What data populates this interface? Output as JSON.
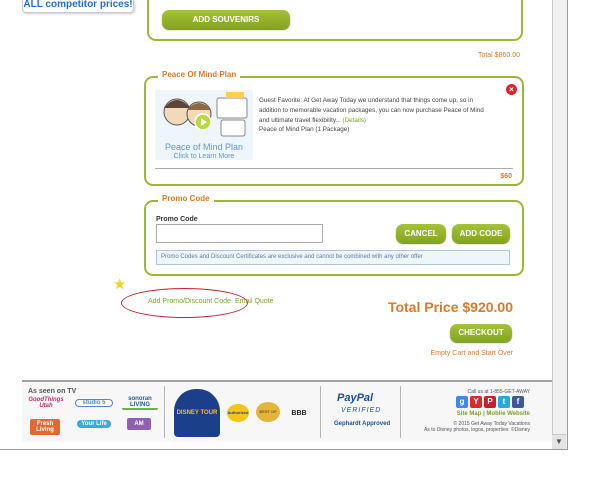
{
  "colors": {
    "accent_green": "#9ab73a",
    "orange": "#d9792a",
    "link_green": "#7ca324",
    "alert_red": "#d8242a"
  },
  "promo_stub": {
    "text": "ALL competitor prices!"
  },
  "souvenirs": {
    "button_label": "ADD SOUVENIRS",
    "total": "Total $860.00"
  },
  "peace_of_mind": {
    "legend": "Peace Of Mind Plan",
    "image_title": "Peace of Mind Plan",
    "image_subtitle": "Click to Learn More",
    "description": "Guest Favorite: At Get Away Today we understand that things come up, so in addition to memorable vacation packages, you can now purchase Peace of Mind and ultimate travel flexibility...",
    "details_link": "(Details)",
    "package_label": "Peace of Mind Plan (1 Package)",
    "price": "$60",
    "remove_icon": "×"
  },
  "promo_code": {
    "legend": "Promo Code",
    "field_label": "Promo Code",
    "input_value": "",
    "cancel_label": "CANCEL",
    "add_label": "ADD CODE",
    "note": "Promo Codes and Discount Certificates are exclusive and cannot be combined with any other offer"
  },
  "links": {
    "add_promo": "Add Promo/Discount Code",
    "email_quote": "Email Quote"
  },
  "annotation": {
    "star_icon": "★"
  },
  "totals": {
    "total_price": "Total Price $920.00",
    "checkout_label": "CHECKOUT",
    "empty_cart": "Empty Cart and Start Over"
  },
  "footer": {
    "as_seen": "As seen on TV",
    "tv_logos": [
      "GoodThings Utah",
      "studio 5",
      "sonoran LIVING",
      "Fresh Living",
      "Your Life",
      "AM"
    ],
    "partner_logos": [
      "DISNEY TOUR",
      "Authorized",
      "BEST OF",
      "BBB"
    ],
    "paypal": "PayPal",
    "paypal_verified": "VERIFIED",
    "gephardt": "Gephardt Approved",
    "call": "Call us at 1-855-GET-AWAY",
    "social": [
      "g",
      "Y",
      "P",
      "t",
      "f"
    ],
    "sitemap": "Site Map | Mobile Website",
    "copyright_1": "© 2015 Get Away Today Vacations",
    "copyright_2": "As to Disney photos, logos, properties: ©Disney"
  },
  "scrollbar": {
    "down_arrow": "▼"
  }
}
